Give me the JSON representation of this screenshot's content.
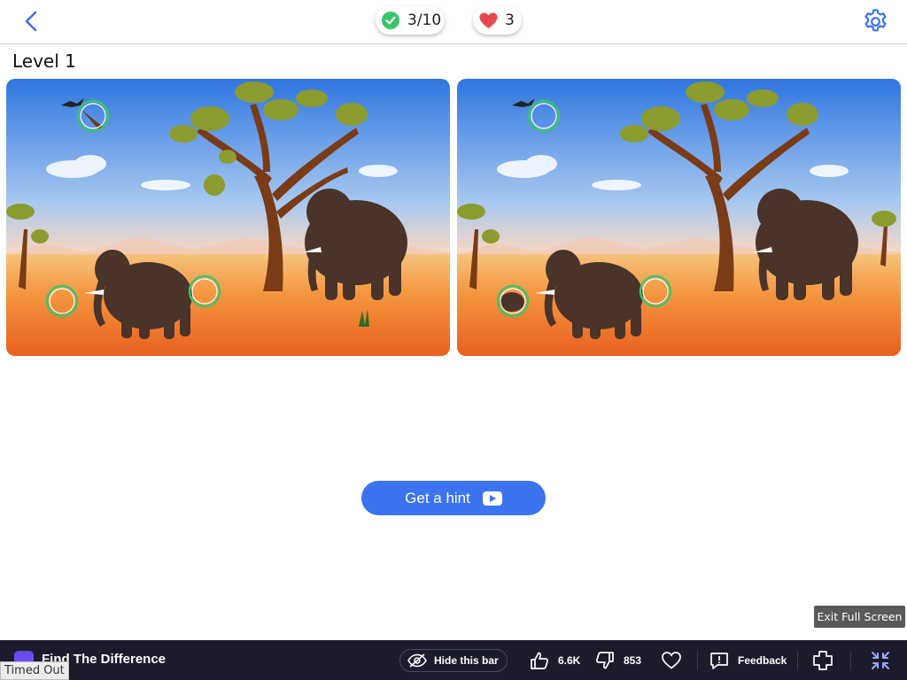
{
  "header": {
    "back_icon": "chevron-left-icon",
    "score": "3/10",
    "lives": "3",
    "settings_icon": "gear-icon"
  },
  "level_title": "Level 1",
  "hint_button": {
    "label": "Get a hint",
    "icon": "video-play-icon"
  },
  "exit_fullscreen": "Exit Full Screen",
  "bottom_bar": {
    "app_title": "Find The Difference",
    "hide_bar_label": "Hide this bar",
    "likes": "6.6K",
    "dislikes": "853",
    "feedback_label": "Feedback",
    "status": "Timed Out"
  },
  "colors": {
    "accent": "#3b73f0",
    "found_marker": "#39c56b",
    "heart": "#e8474d",
    "bar_bg": "#1c1b2b"
  }
}
